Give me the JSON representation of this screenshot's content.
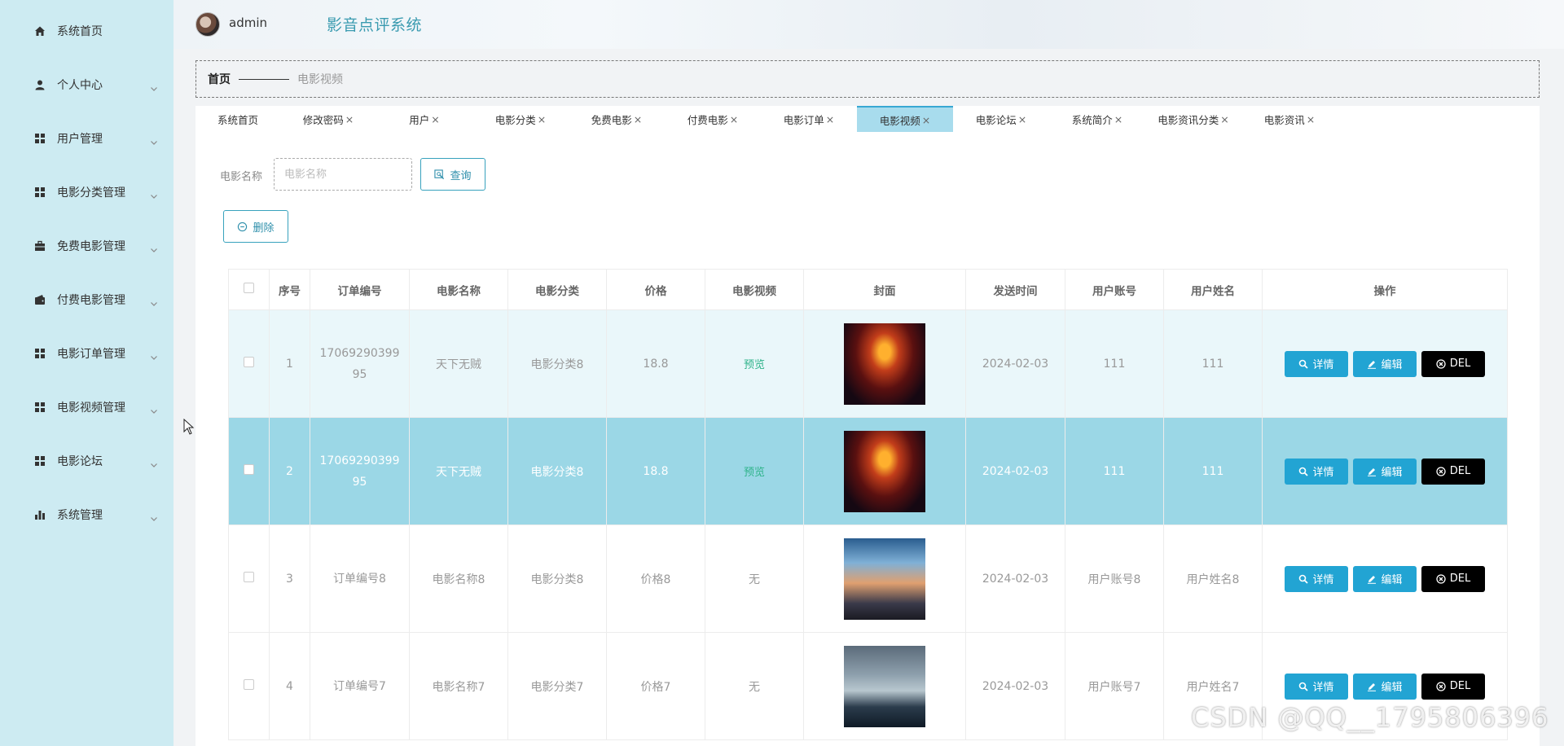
{
  "sidebar": {
    "items": [
      {
        "label": "系统首页",
        "icon": "home-icon",
        "has_chevron": false
      },
      {
        "label": "个人中心",
        "icon": "person-icon",
        "has_chevron": true
      },
      {
        "label": "用户管理",
        "icon": "grid-icon",
        "has_chevron": true
      },
      {
        "label": "电影分类管理",
        "icon": "grid-icon",
        "has_chevron": true
      },
      {
        "label": "免费电影管理",
        "icon": "briefcase-icon",
        "has_chevron": true
      },
      {
        "label": "付费电影管理",
        "icon": "wallet-icon",
        "has_chevron": true
      },
      {
        "label": "电影订单管理",
        "icon": "grid-icon",
        "has_chevron": true
      },
      {
        "label": "电影视频管理",
        "icon": "grid-icon",
        "has_chevron": true
      },
      {
        "label": "电影论坛",
        "icon": "grid-icon",
        "has_chevron": true
      },
      {
        "label": "系统管理",
        "icon": "bar-chart-icon",
        "has_chevron": true
      }
    ]
  },
  "header": {
    "user_name": "admin",
    "app_title": "影音点评系统"
  },
  "breadcrumb": {
    "home": "首页",
    "current": "电影视频"
  },
  "tabs": [
    {
      "label": "系统首页",
      "closable": false,
      "active": false
    },
    {
      "label": "修改密码",
      "closable": true,
      "active": false
    },
    {
      "label": "用户",
      "closable": true,
      "active": false
    },
    {
      "label": "电影分类",
      "closable": true,
      "active": false
    },
    {
      "label": "免费电影",
      "closable": true,
      "active": false
    },
    {
      "label": "付费电影",
      "closable": true,
      "active": false
    },
    {
      "label": "电影订单",
      "closable": true,
      "active": false
    },
    {
      "label": "电影视频",
      "closable": true,
      "active": true
    },
    {
      "label": "电影论坛",
      "closable": true,
      "active": false
    },
    {
      "label": "系统简介",
      "closable": true,
      "active": false
    },
    {
      "label": "电影资讯分类",
      "closable": true,
      "active": false
    },
    {
      "label": "电影资讯",
      "closable": true,
      "active": false
    }
  ],
  "search": {
    "label": "电影名称",
    "placeholder": "电影名称",
    "query_button": "查询",
    "delete_button": "删除"
  },
  "table": {
    "headers": [
      "序号",
      "订单编号",
      "电影名称",
      "电影分类",
      "价格",
      "电影视频",
      "封面",
      "发送时间",
      "用户账号",
      "用户姓名",
      "操作"
    ],
    "rows": [
      {
        "index": "1",
        "order_no": "1706929039995",
        "movie_name": "天下无贼",
        "category": "电影分类8",
        "price": "18.8",
        "video": "预览",
        "video_is_link": true,
        "cover": "poster-a",
        "time": "2024-02-03",
        "account": "111",
        "user_name": "111"
      },
      {
        "index": "2",
        "order_no": "1706929039995",
        "movie_name": "天下无贼",
        "category": "电影分类8",
        "price": "18.8",
        "video": "预览",
        "video_is_link": true,
        "cover": "poster-a",
        "time": "2024-02-03",
        "account": "111",
        "user_name": "111"
      },
      {
        "index": "3",
        "order_no": "订单编号8",
        "movie_name": "电影名称8",
        "category": "电影分类8",
        "price": "价格8",
        "video": "无",
        "video_is_link": false,
        "cover": "poster-b",
        "time": "2024-02-03",
        "account": "用户账号8",
        "user_name": "用户姓名8"
      },
      {
        "index": "4",
        "order_no": "订单编号7",
        "movie_name": "电影名称7",
        "category": "电影分类7",
        "price": "价格7",
        "video": "无",
        "video_is_link": false,
        "cover": "poster-c",
        "time": "2024-02-03",
        "account": "用户账号7",
        "user_name": "用户姓名7"
      }
    ],
    "actions": {
      "detail": "详情",
      "edit": "编辑",
      "delete": "DEL"
    }
  },
  "watermark": "CSDN @QQ__1795806396",
  "colors": {
    "sidebar_bg": "#cdebf2",
    "accent": "#22a4d3",
    "active_tab": "#a8dced",
    "selected_row": "#9bd7e6",
    "title": "#3a9bb0"
  }
}
